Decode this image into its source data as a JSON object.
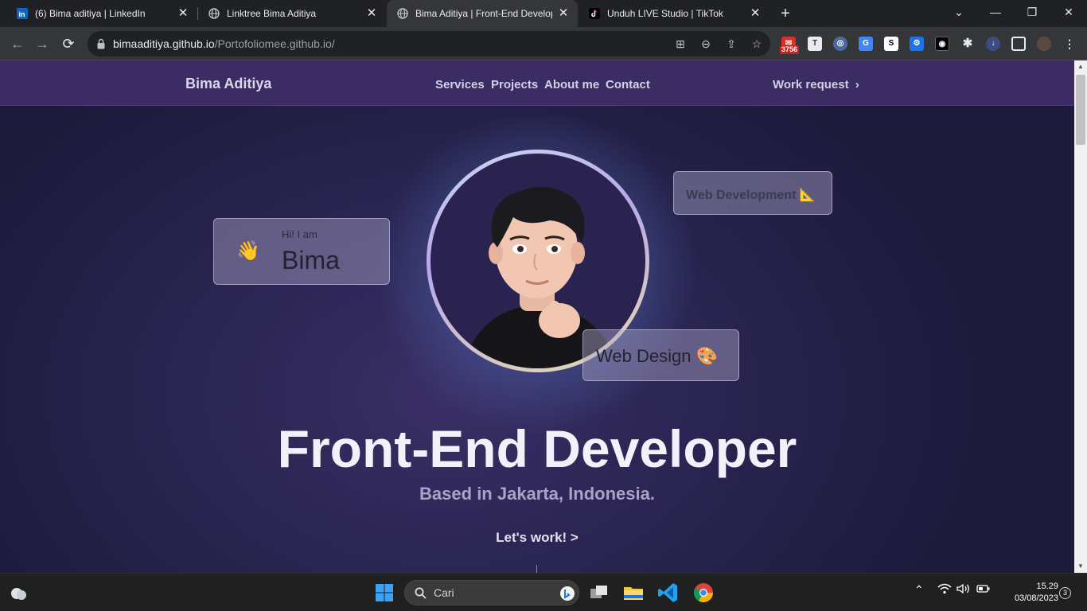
{
  "browser": {
    "tabs": [
      {
        "title": "(6) Bima aditiya | LinkedIn",
        "icon": "linkedin-icon",
        "active": false
      },
      {
        "title": "Linktree Bima Aditiya",
        "icon": "globe-icon",
        "active": false
      },
      {
        "title": "Bima Aditiya | Front-End Developer",
        "icon": "globe-icon",
        "active": true
      },
      {
        "title": "Unduh LIVE Studio | TikTok",
        "icon": "tiktok-icon",
        "active": false
      }
    ],
    "url_host": "bimaaditiya.github.io",
    "url_path": "/Portofoliomee.github.io/",
    "extension_badge": "3756"
  },
  "site": {
    "brand": "Bima Aditiya",
    "nav": [
      "Services",
      "Projects",
      "About me",
      "Contact"
    ],
    "work_request": "Work request",
    "greeting_small": "Hi! I am",
    "greeting_name": "Bima",
    "wave_emoji": "👋",
    "tag_dev": "Web Development",
    "tag_dev_icon": "📐",
    "tag_design": "Web Design",
    "tag_design_icon": "🎨",
    "hero_title": "Front-End Developer",
    "hero_subtitle": "Based in Jakarta, Indonesia.",
    "cta": "Let's work! >"
  },
  "taskbar": {
    "search_placeholder": "Cari",
    "time": "15.29",
    "date": "03/08/2023",
    "notification_count": "3"
  },
  "colors": {
    "page_bg": "#1f1e3d",
    "nav_bg": "#3b2c63",
    "accent": "#e8a33d"
  }
}
